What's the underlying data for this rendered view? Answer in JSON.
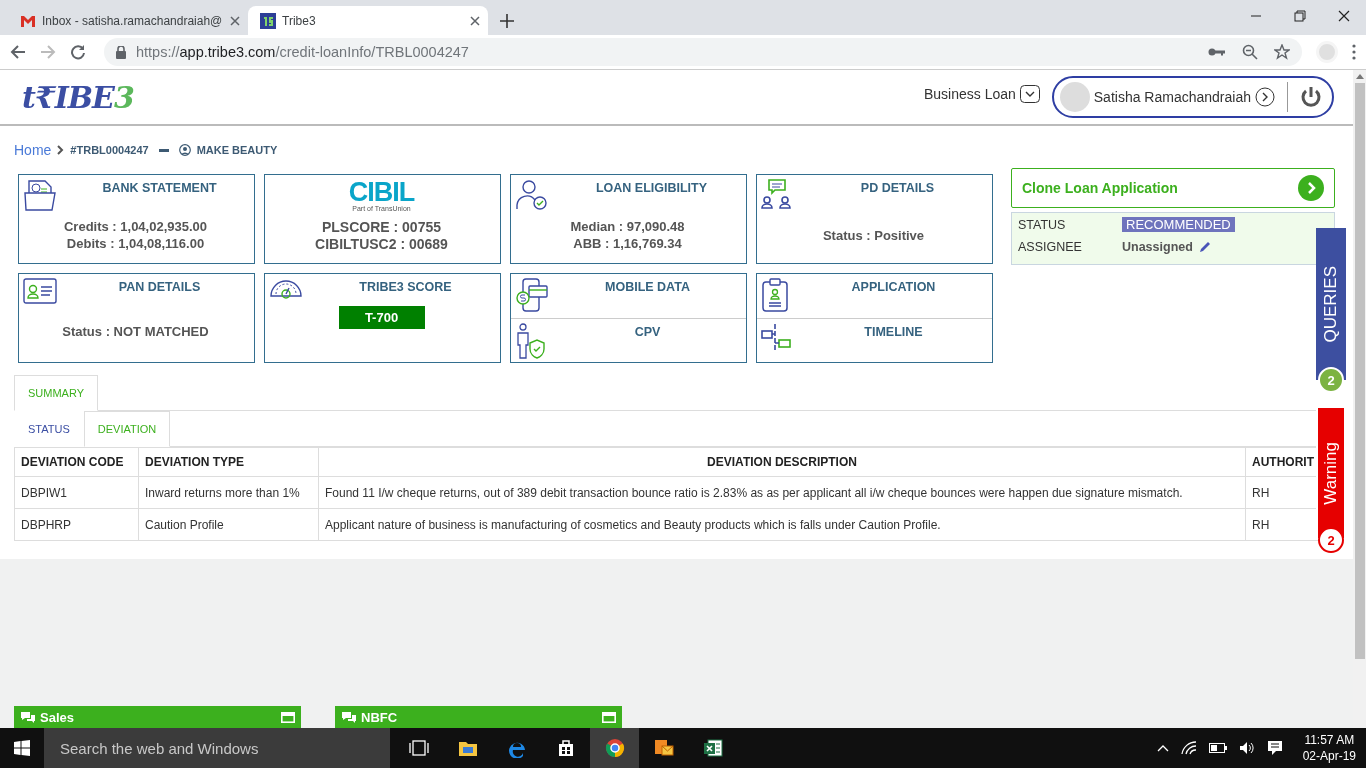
{
  "browser": {
    "tabs": [
      {
        "title": "Inbox - satisha.ramachandraiah@",
        "selected": false
      },
      {
        "title": "Tribe3",
        "selected": true
      }
    ],
    "url": {
      "scheme": "https://",
      "host": "app.tribe3.com",
      "path": "/credit-loanInfo/TRBL0004247"
    }
  },
  "header": {
    "logo": {
      "main": "t₹IBE",
      "accent": "3"
    },
    "loan_type": "Business Loan",
    "user_name": "Satisha Ramachandraiah"
  },
  "breadcrumb": {
    "home": "Home",
    "loan_id": "#TRBL0004247",
    "customer": "MAKE BEAUTY"
  },
  "cards": [
    {
      "kind": "standard",
      "title": "BANK STATEMENT",
      "lines": [
        "Credits : 1,04,02,935.00",
        "Debits : 1,04,08,116.00"
      ]
    },
    {
      "kind": "logo",
      "logo": "CIBIL",
      "tagline": "Part of TransUnion",
      "lines": [
        "PLSCORE : 00755",
        "CIBILTUSC2 : 00689"
      ]
    },
    {
      "kind": "standard",
      "title": "LOAN ELIGIBILITY",
      "lines": [
        "Median : 97,090.48",
        "ABB : 1,16,769.34"
      ]
    },
    {
      "kind": "standard",
      "title": "PD DETAILS",
      "lines": [
        "Status : Positive"
      ]
    },
    {
      "kind": "standard",
      "title": "PAN DETAILS",
      "lines": [
        "Status : NOT MATCHED"
      ]
    },
    {
      "kind": "score",
      "title": "TRIBE3 SCORE",
      "score": "T-700"
    },
    {
      "kind": "split",
      "sections": [
        "MOBILE DATA",
        "CPV"
      ]
    },
    {
      "kind": "split",
      "sections": [
        "APPLICATION",
        "TIMELINE"
      ]
    }
  ],
  "clone_button": "Clone Loan Application",
  "status_panel": [
    {
      "label": "STATUS",
      "value": "RECOMMENDED",
      "kind": "badge"
    },
    {
      "label": "ASSIGNEE",
      "value": "Unassigned",
      "kind": "editable"
    }
  ],
  "side_tabs": [
    {
      "label": "QUERIES",
      "count": "2",
      "kind": "queries"
    },
    {
      "label": "Warning",
      "count": "2",
      "kind": "warning"
    }
  ],
  "tabs": [
    {
      "label": "SUMMARY",
      "selected": true
    }
  ],
  "sub_tabs": [
    {
      "label": "STATUS",
      "selected": false
    },
    {
      "label": "DEVIATION",
      "selected": true
    }
  ],
  "table": {
    "columns": [
      "DEVIATION CODE",
      "DEVIATION TYPE",
      "DEVIATION DESCRIPTION",
      "AUTHORIT"
    ],
    "rows": [
      [
        "DBPIW1",
        "Inward returns more than 1%",
        "Found 11 I/w cheque returns, out of 389 debit transaction bounce ratio is 2.83% as as per applicant all i/w cheque bounces were happen due signature mismatch.",
        "RH"
      ],
      [
        "DBPHRP",
        "Caution Profile",
        "Applicant nature of business is manufacturing of cosmetics and Beauty products which is falls under Caution Profile.",
        "RH"
      ]
    ]
  },
  "chat_bars": [
    "Sales",
    "NBFC"
  ],
  "taskbar": {
    "search_placeholder": "Search the web and Windows",
    "apps": [
      {
        "selected": false
      },
      {
        "selected": false
      },
      {
        "selected": false
      },
      {
        "selected": false
      },
      {
        "selected": true
      },
      {
        "selected": false
      },
      {
        "selected": false
      }
    ],
    "time": "11:57 AM",
    "date": "02-Apr-19"
  }
}
